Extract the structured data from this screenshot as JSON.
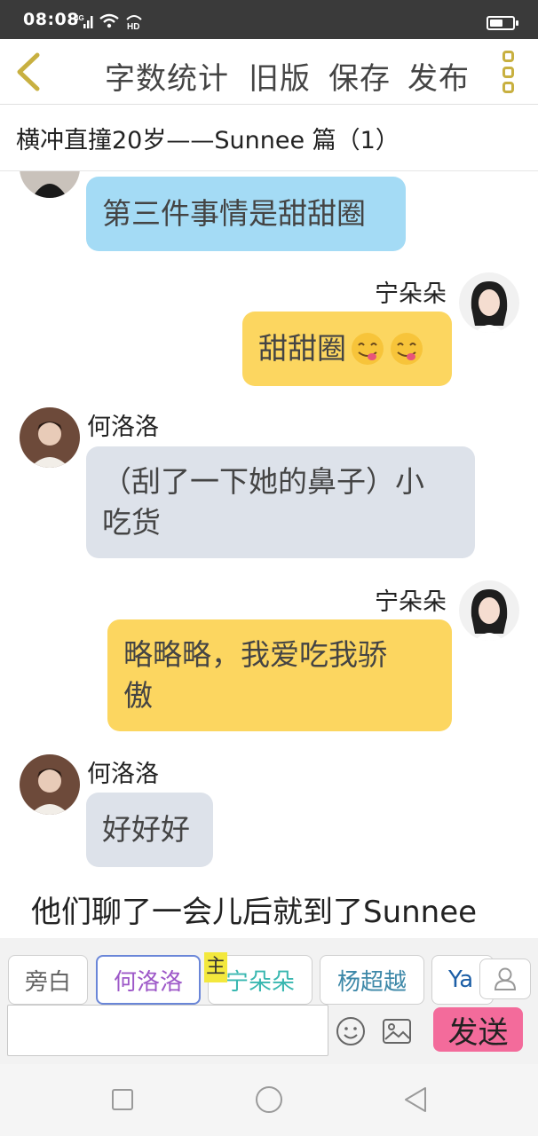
{
  "status_bar": {
    "time": "08:08",
    "network": "4G",
    "wifi_badge": "HD",
    "battery_level": 0.6
  },
  "toolbar": {
    "back_icon": "chevron-left-icon",
    "word_count": "字数统计",
    "old_version": "旧版",
    "save": "保存",
    "publish": "发布",
    "more_icon": "more-vertical-icon"
  },
  "story": {
    "title": "横冲直撞20岁——Sunnee 篇（1）"
  },
  "messages": [
    {
      "speaker": "",
      "side": "left",
      "text": "第三件事情是甜甜圈",
      "color": "#a4dbf5"
    },
    {
      "speaker": "宁朵朵",
      "side": "right",
      "text": "甜甜圈",
      "emoji": "yum-face-icon",
      "color": "#fcd660"
    },
    {
      "speaker": "何洛洛",
      "side": "left",
      "line1": "（刮了一下她的鼻子）小",
      "line2": "吃货",
      "color": "#dde2ea"
    },
    {
      "speaker": "宁朵朵",
      "side": "right",
      "line1": "略略略，我爱吃我骄",
      "line2": "傲",
      "color": "#fcd660"
    },
    {
      "speaker": "何洛洛",
      "side": "left",
      "text": "好好好",
      "color": "#dde2ea"
    }
  ],
  "narration": "他们聊了一会儿后就到了Sunnee",
  "roles": {
    "narrator": "旁白",
    "he": "何洛洛",
    "ning": "宁朵朵",
    "yang": "杨超越",
    "ya": "Ya",
    "main_tag": "主"
  },
  "input": {
    "placeholder": "",
    "send": "发送"
  },
  "nav": {
    "square": "recent-apps-icon",
    "circle": "home-icon",
    "back": "back-triangle-icon"
  }
}
